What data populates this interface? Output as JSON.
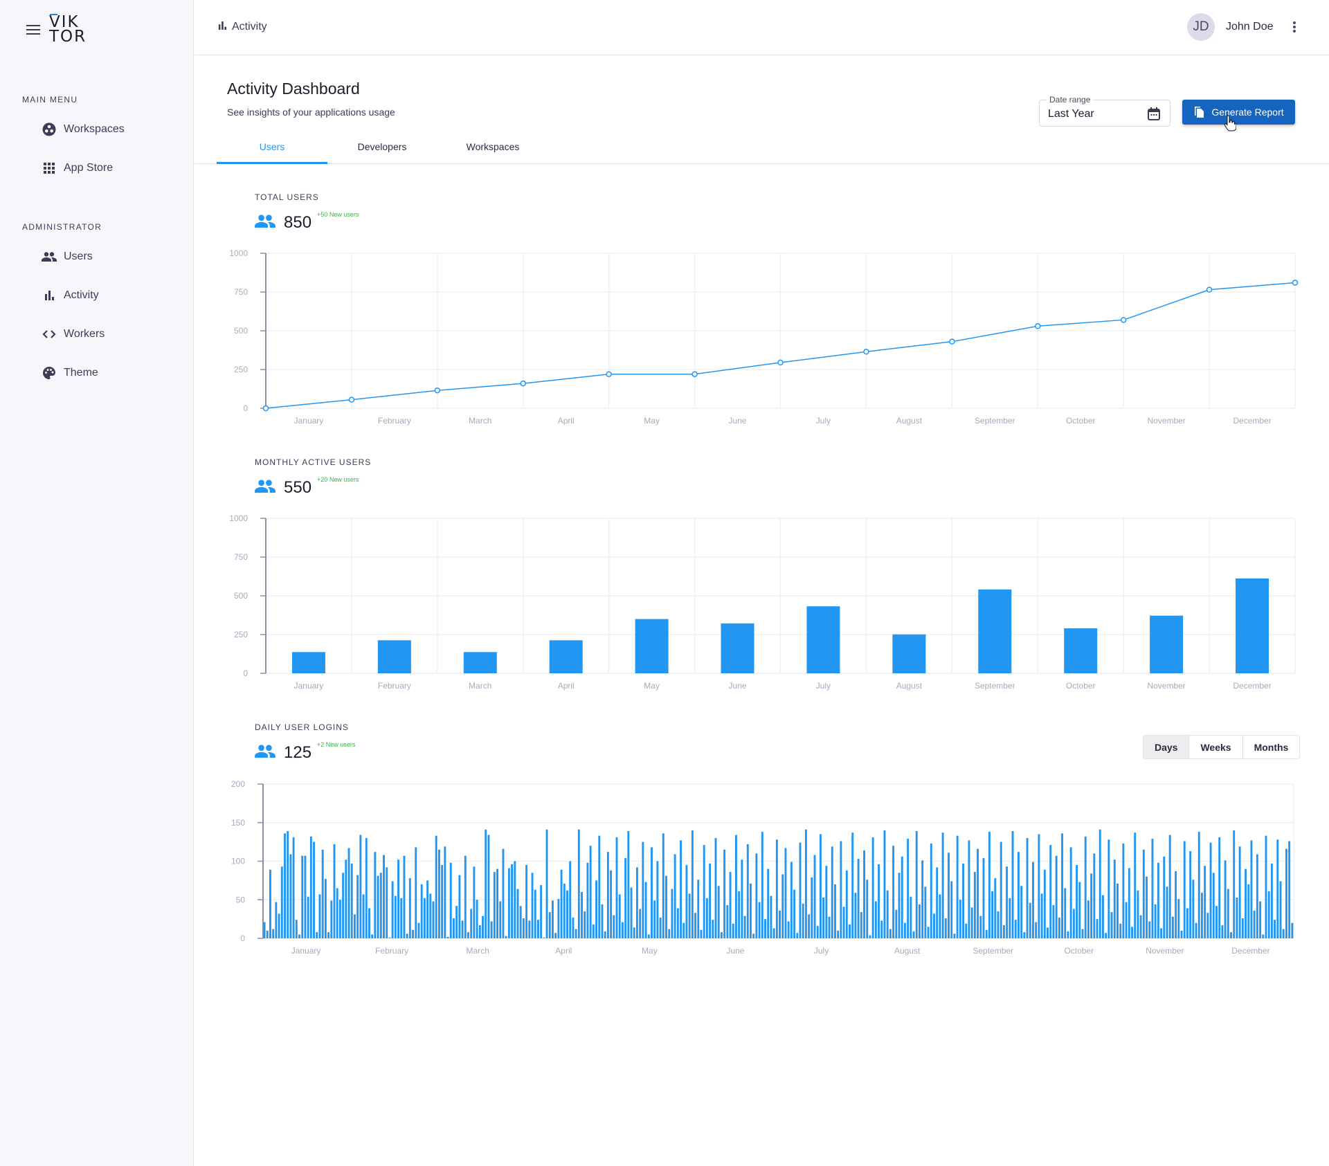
{
  "app": {
    "logo_line1": "VIK",
    "logo_line2": "TOR"
  },
  "sidebar": {
    "sections": [
      {
        "title": "MAIN MENU",
        "items": [
          {
            "label": "Workspaces",
            "icon": "workspaces-icon"
          },
          {
            "label": "App Store",
            "icon": "apps-grid-icon"
          }
        ]
      },
      {
        "title": "ADMINISTRATOR",
        "items": [
          {
            "label": "Users",
            "icon": "users-icon"
          },
          {
            "label": "Activity",
            "icon": "bar-chart-icon"
          },
          {
            "label": "Workers",
            "icon": "code-icon"
          },
          {
            "label": "Theme",
            "icon": "palette-icon"
          }
        ]
      }
    ]
  },
  "header": {
    "breadcrumb": "Activity",
    "user": {
      "initials": "JD",
      "name": "John Doe"
    }
  },
  "page": {
    "title": "Activity Dashboard",
    "subtitle": "See insights of your applications usage",
    "tabs": [
      {
        "label": "Users",
        "active": true
      },
      {
        "label": "Developers"
      },
      {
        "label": "Workspaces"
      }
    ],
    "date_range": {
      "label": "Date range",
      "value": "Last Year"
    },
    "generate_label": "Generate Report"
  },
  "colors": {
    "accent": "#2196f3",
    "button": "#1565c0",
    "positive": "#3bb04a"
  },
  "cards": [
    {
      "label": "TOTAL USERS",
      "value": "850",
      "delta": "+50 New users"
    },
    {
      "label": "MONTHLY ACTIVE USERS",
      "value": "550",
      "delta": "+20 New users"
    },
    {
      "label": "DAILY USER LOGINS",
      "value": "125",
      "delta": "+2 New users",
      "toggle": [
        {
          "label": "Days",
          "active": true
        },
        {
          "label": "Weeks"
        },
        {
          "label": "Months"
        }
      ]
    }
  ],
  "chart_data": [
    {
      "type": "line",
      "categories": [
        "January",
        "February",
        "March",
        "April",
        "May",
        "June",
        "July",
        "August",
        "September",
        "October",
        "November",
        "December"
      ],
      "values": [
        0,
        55,
        115,
        160,
        220,
        220,
        295,
        365,
        430,
        530,
        570,
        765,
        810
      ],
      "yticks": [
        "0",
        "250",
        "500",
        "750",
        "1000"
      ],
      "ylim": [
        0,
        1000
      ],
      "grid": true
    },
    {
      "type": "bar",
      "categories": [
        "January",
        "February",
        "March",
        "April",
        "May",
        "June",
        "July",
        "August",
        "September",
        "October",
        "November",
        "December"
      ],
      "values": [
        137,
        213,
        137,
        213,
        350,
        322,
        432,
        251,
        541,
        290,
        372,
        612
      ],
      "yticks": [
        "0",
        "250",
        "500",
        "750",
        "1000"
      ],
      "ylim": [
        0,
        1000
      ],
      "grid": true
    },
    {
      "type": "bar",
      "categories": [
        "January",
        "February",
        "March",
        "April",
        "May",
        "June",
        "July",
        "August",
        "September",
        "October",
        "November",
        "December"
      ],
      "yticks": [
        "0",
        "50",
        "100",
        "150",
        "200"
      ],
      "ylim": [
        0,
        200
      ],
      "grid": true,
      "values": [
        21,
        10,
        89,
        12,
        47,
        32,
        93,
        136,
        139,
        109,
        131,
        24,
        5,
        107,
        107,
        54,
        132,
        125,
        8,
        57,
        115,
        77,
        8,
        49,
        122,
        65,
        50,
        85,
        102,
        117,
        97,
        31,
        82,
        134,
        57,
        130,
        39,
        5,
        112,
        81,
        85,
        108,
        92,
        1,
        74,
        55,
        102,
        52,
        107,
        6,
        78,
        11,
        118,
        20,
        70,
        52,
        75,
        58,
        48,
        133,
        115,
        95,
        119,
        2,
        98,
        26,
        42,
        82,
        23,
        107,
        8,
        38,
        93,
        50,
        17,
        29,
        141,
        134,
        22,
        86,
        90,
        48,
        116,
        3,
        91,
        96,
        100,
        64,
        42,
        26,
        95,
        23,
        85,
        63,
        24,
        69,
        1,
        141,
        34,
        49,
        7,
        51,
        89,
        71,
        62,
        100,
        27,
        12,
        141,
        60,
        35,
        98,
        120,
        18,
        75,
        133,
        44,
        9,
        112,
        88,
        30,
        131,
        57,
        21,
        104,
        139,
        66,
        14,
        92,
        38,
        125,
        73,
        5,
        118,
        49,
        100,
        27,
        136,
        81,
        12,
        64,
        109,
        39,
        127,
        20,
        95,
        58,
        140,
        33,
        76,
        11,
        121,
        52,
        97,
        24,
        130,
        68,
        8,
        115,
        43,
        86,
        19,
        134,
        61,
        102,
        29,
        122,
        71,
        6,
        110,
        47,
        138,
        25,
        90,
        55,
        13,
        128,
        36,
        83,
        117,
        22,
        99,
        63,
        7,
        124,
        45,
        141,
        31,
        79,
        108,
        16,
        135,
        53,
        94,
        28,
        119,
        70,
        10,
        126,
        41,
        88,
        18,
        137,
        59,
        103,
        34,
        114,
        76,
        4,
        131,
        48,
        96,
        23,
        140,
        62,
        12,
        120,
        37,
        85,
        106,
        20,
        129,
        54,
        9,
        139,
        44,
        101,
        67,
        15,
        123,
        32,
        92,
        57,
        137,
        26,
        111,
        74,
        6,
        133,
        50,
        97,
        19,
        127,
        40,
        86,
        116,
        29,
        104,
        11,
        138,
        61,
        78,
        35,
        125,
        17,
        93,
        52,
        139,
        24,
        112,
        68,
        8,
        130,
        46,
        99,
        21,
        135,
        58,
        89,
        14,
        121,
        43,
        107,
        27,
        136,
        65,
        9,
        118,
        38,
        95,
        73,
        12,
        132,
        49,
        84,
        110,
        25,
        141,
        56,
        7,
        128,
        34,
        102,
        71,
        19,
        123,
        47,
        91,
        15,
        137,
        62,
        30,
        115,
        80,
        22,
        129,
        44,
        98,
        13,
        106,
        67,
        134,
        28,
        87,
        51,
        10,
        126,
        39,
        113,
        76,
        20,
        138,
        59,
        94,
        33,
        124,
        85,
        42,
        131,
        17,
        101,
        64,
        8,
        140,
        53,
        119,
        26,
        90,
        70,
        127,
        36,
        109,
        48,
        5,
        133,
        61,
        97,
        24,
        128,
        74,
        12,
        116,
        126,
        20
      ]
    }
  ]
}
